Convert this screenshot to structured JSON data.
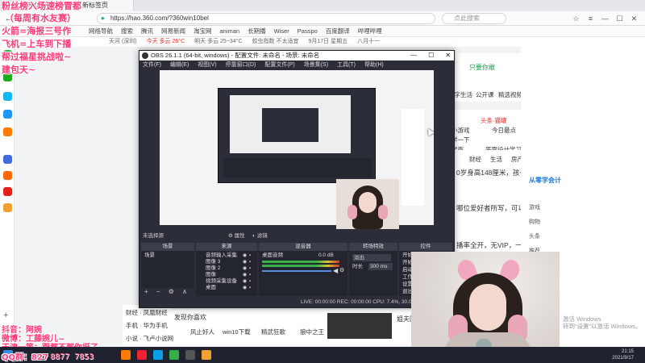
{
  "browser": {
    "tabs": [
      {
        "label": "360导航"
      },
      {
        "label": "新标签页"
      }
    ],
    "nav": {
      "back": "←",
      "forward": "→",
      "reload": "⟳",
      "home": "⌂"
    },
    "url": "https://hao.360.com/?360win10bel",
    "search_placeholder": "点此搜索",
    "bookmarks": [
      "网络导航",
      "搜索",
      "腾讯",
      "网易新闻",
      "淘宝网",
      "animan",
      "长期播",
      "Wiser",
      "Passpo",
      "百度翻译",
      "哔哩哔哩"
    ],
    "info": [
      "天河 (深圳)",
      "今天 多云 26°C",
      "明天 多云 25~34°C",
      "蚊虫指数 不太适宜",
      "9月17日 星期五",
      "八月十一"
    ]
  },
  "page": {
    "right_links": [
      "数字生活",
      "公开课",
      "精选视频",
      "直播",
      "游戏"
    ],
    "headline": "只要你敢",
    "categories": [
      "财经",
      "生活",
      "房产",
      "汽车"
    ],
    "snippets": [
      "0岁身高148厘米，孩子",
      "哪位爱好者所写，可以吗",
      "播率全开，无VIP，一键"
    ],
    "bottom_items": [
      "发现你喜欢",
      "风止好人",
      "win10下载",
      "精武狂歌",
      "狼中之王"
    ],
    "left_items": [
      "财经 · 凤凰财经",
      "手机 · 华为手机",
      "小说 · 飞卢小说网"
    ],
    "promo": [
      "头条·猫罐",
      "小游戏",
      "今日最点",
      "学一下",
      "学而",
      "平面设计学习"
    ]
  },
  "sidebar": {
    "items": [
      "从零学会计",
      "游戏",
      "购物",
      "头条",
      "推荐"
    ]
  },
  "obs": {
    "title": "OBS 26.1.1 (64-bit, windows) - 配置文件: 未命名 - 场景: 未命名",
    "menu": [
      "文件(F)",
      "编辑(E)",
      "视图(V)",
      "停靠窗口(D)",
      "配置文件(P)",
      "场景集(S)",
      "工具(T)",
      "帮助(H)"
    ],
    "window_controls": [
      "—",
      "☐",
      "✕"
    ],
    "inactive_label": "未选择源",
    "props_button": "属性",
    "filters_button": "滤镜",
    "dock_headers": [
      "场景",
      "来源",
      "混音器",
      "转场特效",
      "控件"
    ],
    "scenes": [
      "场景"
    ],
    "sources": [
      "音频输入采集",
      "图像 3",
      "图像 2",
      "图像",
      "视频采集设备",
      "桌面"
    ],
    "mixer_label": "桌面音频",
    "mixer_level": "0.0 dB",
    "transition": "淡出",
    "duration_label": "时长",
    "duration": "300 ms",
    "controls": [
      "开始推流",
      "开始录制",
      "启动虚拟摄像机",
      "工作室模式",
      "设置",
      "退出"
    ],
    "status": "LIVE: 00:00:00   REC: 00:00:00   CPU: 7.4%, 30.00 fps",
    "dock_buttons": "+ − ⚙ ∧ ∨"
  },
  "overlay": {
    "top_lines": [
      "粉丝榜入场速榜冒都",
      "（每周有水友赛）",
      "火箭=海报三号作",
      "飞机=上车到下播",
      "帮过福星挑战啦~",
      "建包天~"
    ],
    "bottom_lines": [
      "抖音：阿婉",
      "微博：工藤婉儿~",
      "天津一等：跟都不那你挺了",
      "QQ群：827"
    ],
    "counter": "8877 7853"
  },
  "windows": {
    "activate": "激活 Windows",
    "activate_sub": "转到“设置”以激活 Windows。"
  },
  "taskbar": {
    "time": "21:15",
    "date": "2021/9/17"
  },
  "colors": {
    "obs_bg": "#2b2e38",
    "overlay_text": "#ff3a7a",
    "taskbar": "#1f2330"
  },
  "icons": [
    "back-icon",
    "forward-icon",
    "reload-icon",
    "home-icon",
    "lock-icon",
    "star-icon",
    "menu-icon",
    "minimize-icon",
    "maximize-icon",
    "close-icon",
    "gear-icon",
    "eye-icon",
    "lock-source-icon",
    "speaker-icon",
    "windows-start-icon"
  ]
}
